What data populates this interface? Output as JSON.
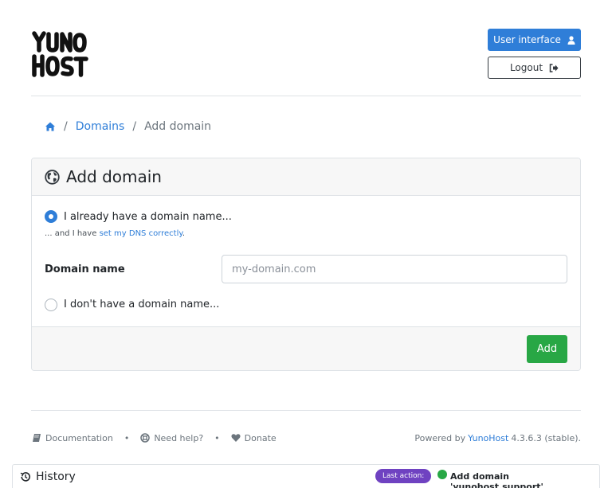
{
  "header": {
    "logo_text_line1": "YUNO",
    "logo_text_line2": "HOST",
    "user_interface_label": "User interface",
    "logout_label": "Logout"
  },
  "breadcrumb": {
    "items": [
      "Domains",
      "Add domain"
    ]
  },
  "card": {
    "title": "Add domain",
    "option_have": "I already have a domain name...",
    "help_prefix": "... and I have ",
    "help_link": "set my DNS correctly",
    "help_suffix": ".",
    "field_label": "Domain name",
    "field_placeholder": "my-domain.com",
    "field_value": "",
    "option_not_have": "I don't have a domain name...",
    "add_label": "Add"
  },
  "footer": {
    "documentation": "Documentation",
    "need_help": "Need help?",
    "donate": "Donate",
    "separator": "•",
    "powered_prefix": "Powered by",
    "powered_link": "YunoHost",
    "version": "4.3.6.3 (stable)."
  },
  "history": {
    "title": "History",
    "last_action_label": "Last action:",
    "last_action_text": "Add domain 'yunohost.support'",
    "last_action_status_color": "#28a745"
  },
  "colors": {
    "primary": "#2f7ed8",
    "success": "#28a745",
    "badge": "#6f42c1"
  }
}
